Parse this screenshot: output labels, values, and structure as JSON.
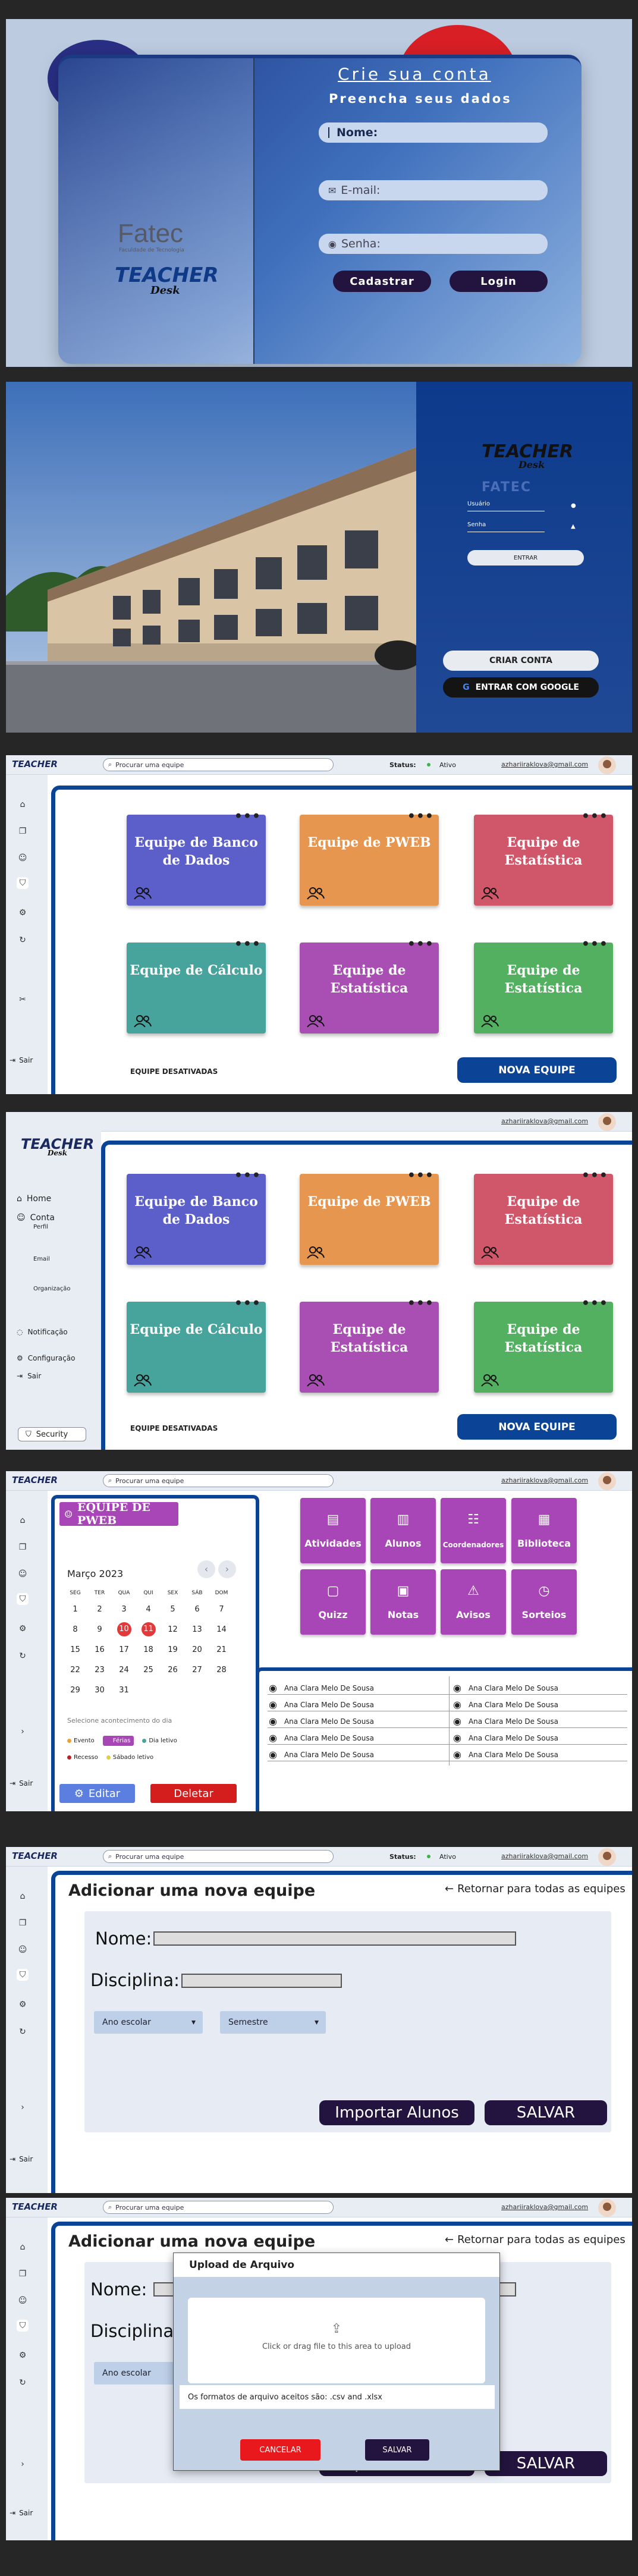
{
  "signup": {
    "title": "Crie sua conta",
    "subtitle": "Preencha seus dados",
    "name_label": "Nome:",
    "email_label": "E-mail:",
    "password_label": "Senha:",
    "register_button": "Cadastrar",
    "login_button": "Login",
    "fatec_logo": "Fatec",
    "fatec_sub": "Faculdade de Tecnologia",
    "teacher_logo": "TEACHER",
    "teacher_script": "Desk"
  },
  "login": {
    "logo": "TEACHER",
    "logo_script": "Desk",
    "building_sign": "FATEC",
    "user_placeholder": "Usuário",
    "password_placeholder": "Senha",
    "enter_button": "ENTRAR",
    "create_account_button": "CRIAR CONTA",
    "google_button": "ENTRAR COM GOOGLE"
  },
  "header": {
    "search_placeholder": "Procurar uma equipe",
    "status_label": "Status:",
    "status_value": "Ativo",
    "email": "azhariiraklova@gmail.com",
    "logout": "Sair"
  },
  "teams": {
    "cards": [
      {
        "name": "Equipe de Banco de Dados",
        "color": "#5c5fca"
      },
      {
        "name": "Equipe de PWEB",
        "color": "#e7964f"
      },
      {
        "name": "Equipe de Estatística",
        "color": "#d0566a"
      },
      {
        "name": "Equipe de Cálculo",
        "color": "#47a49d"
      },
      {
        "name": "Equipe de Estatística",
        "color": "#a94fb3"
      },
      {
        "name": "Equipe de Estatística",
        "color": "#52b060"
      }
    ],
    "disabled_label": "EQUIPE DESATIVADAS",
    "new_team_button": "NOVA EQUIPE",
    "more_icon": "•••"
  },
  "menu": {
    "home": "Home",
    "account": "Conta",
    "profile": "Perfil",
    "email": "Email",
    "organization": "Organização",
    "notification": "Notificação",
    "settings": "Configuração",
    "logout": "Sair",
    "security": "Security"
  },
  "team_detail": {
    "team_name": "EQUIPE DE PWEB",
    "month": "Março 2023",
    "weekdays": [
      "SEG",
      "TER",
      "QUA",
      "QUI",
      "SEX",
      "SÁB",
      "DOM"
    ],
    "weeks": [
      [
        "1",
        "2",
        "3",
        "4",
        "5",
        "6",
        "7"
      ],
      [
        "8",
        "9",
        "10",
        "11",
        "12",
        "13",
        "14"
      ],
      [
        "15",
        "16",
        "17",
        "18",
        "19",
        "20",
        "21"
      ],
      [
        "22",
        "23",
        "24",
        "25",
        "26",
        "27",
        "28"
      ],
      [
        "29",
        "30",
        "31",
        "",
        "",
        "",
        ""
      ]
    ],
    "select_event": "Selecione acontecimento do dia",
    "legend": [
      {
        "label": "Evento",
        "color": "#f0a030"
      },
      {
        "label": "Férias",
        "color": "#a846b8"
      },
      {
        "label": "Dia letivo",
        "color": "#47a49d"
      },
      {
        "label": "Recesso",
        "color": "#c02020"
      },
      {
        "label": "Sábado letivo",
        "color": "#e0d040"
      }
    ],
    "edit_button": "Editar",
    "delete_button": "Deletar",
    "features": [
      "Atividades",
      "Alunos",
      "Coordenadores",
      "Biblioteca",
      "Quizz",
      "Notas",
      "Avisos",
      "Sorteios"
    ],
    "members": [
      "Ana Clara Melo De Sousa",
      "Ana Clara Melo De Sousa",
      "Ana Clara Melo De Sousa",
      "Ana Clara Melo De Sousa",
      "Ana Clara Melo De Sousa",
      "Ana Clara Melo De Sousa",
      "Ana Clara Melo De Sousa",
      "Ana Clara Melo De Sousa",
      "Ana Clara Melo De Sousa",
      "Ana Clara Melo De Sousa"
    ]
  },
  "add_team": {
    "title": "Adicionar uma nova equipe",
    "back_link": "Retornar para todas as equipes",
    "name_label": "Nome:",
    "subject_label": "Disciplina:",
    "year_select": "Ano escolar",
    "semester_select": "Semestre",
    "import_button": "Importar Alunos",
    "save_button": "SALVAR"
  },
  "upload": {
    "title": "Upload de Arquivo",
    "drop_text": "Click or drag file to this area to upload",
    "formats_text": "Os formatos de arquivo aceitos são: .csv and .xlsx",
    "cancel_button": "CANCELAR",
    "save_button": "SALVAR"
  }
}
